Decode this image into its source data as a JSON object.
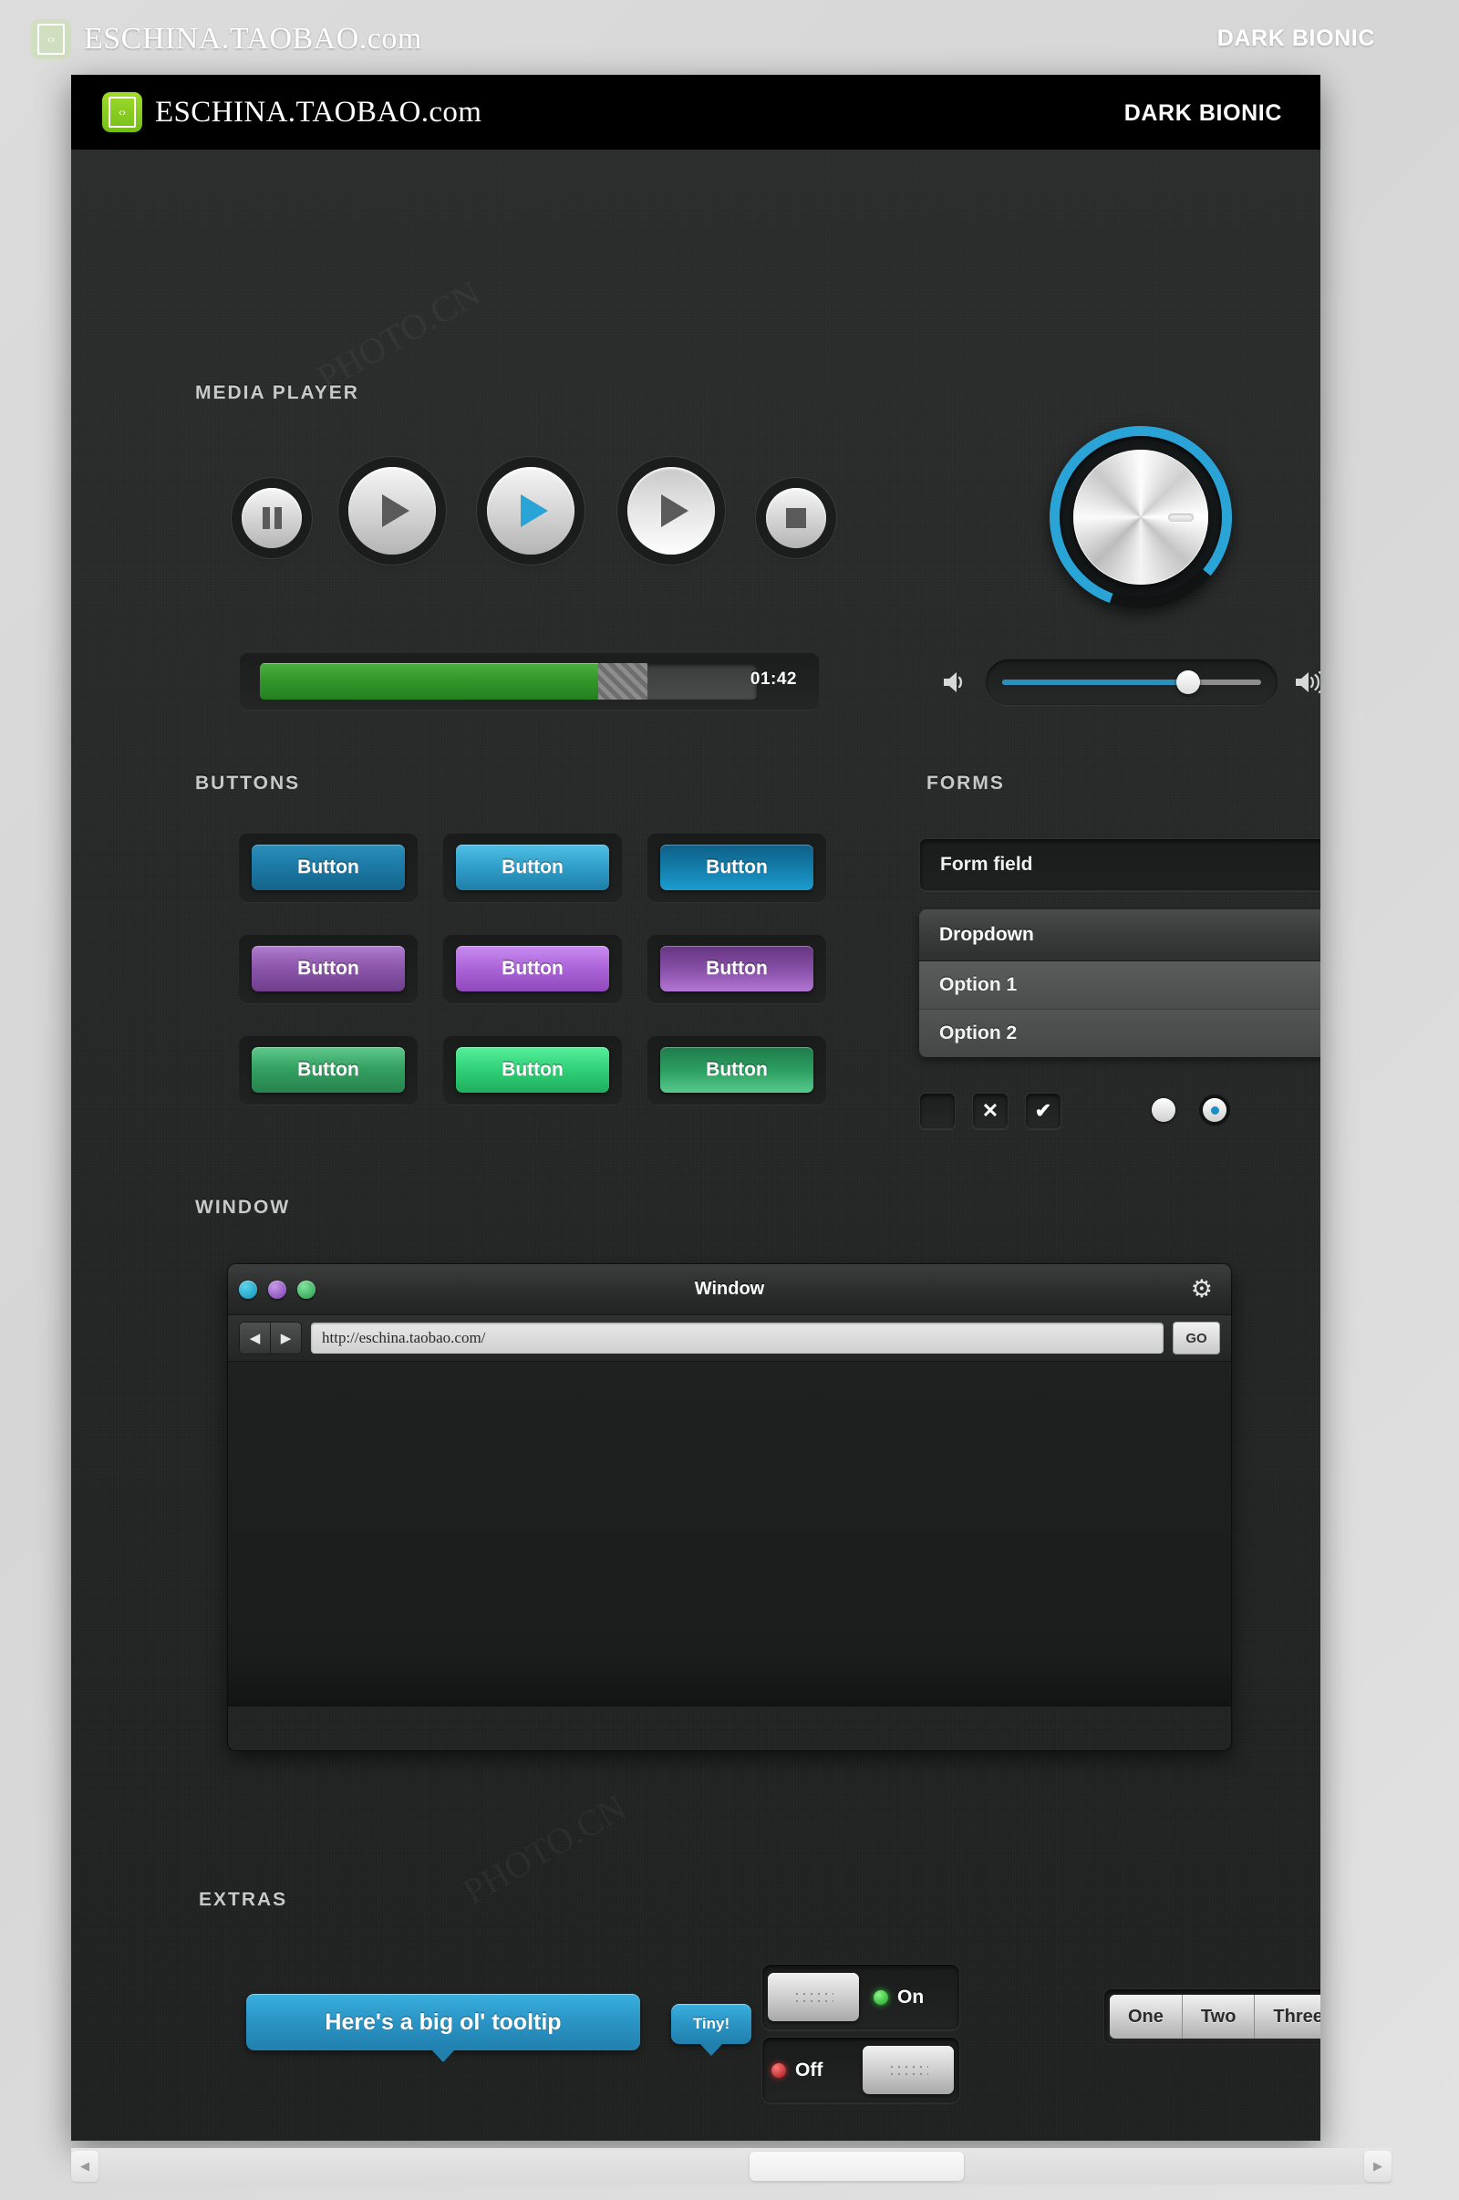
{
  "outer": {
    "brand": "ESCHINA.TAOBAO.com",
    "theme_label": "DARK BIONIC",
    "logo_icon": "code-brackets-icon"
  },
  "kit": {
    "brand": "ESCHINA.TAOBAO.com",
    "theme_label": "DARK BIONIC",
    "logo_icon": "code-brackets-icon",
    "accent_blue": "#2a94c4",
    "accent_green": "#2f9329",
    "panel_bg": "#242626"
  },
  "media_player": {
    "title": "MEDIA PLAYER",
    "transport": [
      {
        "name": "pause-button",
        "icon": "pause-icon",
        "size": "small",
        "color": "#5a5a5a"
      },
      {
        "name": "play-button-large",
        "icon": "play-icon",
        "size": "large",
        "color": "#5a5a5a"
      },
      {
        "name": "play-button-active",
        "icon": "play-icon",
        "size": "large",
        "color": "#2aa4d6"
      },
      {
        "name": "play-button-pressed",
        "icon": "play-icon",
        "size": "large",
        "color": "#5a5a5a"
      },
      {
        "name": "stop-button",
        "icon": "stop-icon",
        "size": "small",
        "color": "#5a5a5a"
      }
    ],
    "progress": {
      "played_percent": 68,
      "buffered_percent": 10,
      "time": "01:42"
    },
    "knob": {
      "name": "volume-knob",
      "value_percent": 80,
      "ring_color": "#2aa4d6"
    },
    "volume": {
      "icon_low": "speaker-low-icon",
      "icon_high": "speaker-high-icon",
      "value_percent": 72,
      "fill_color": "#2a8fba"
    }
  },
  "buttons_section": {
    "title": "BUTTONS",
    "label": "Button",
    "rows": [
      {
        "name": "blue",
        "variants": [
          {
            "state": "normal",
            "gradient": "linear-gradient(180deg,#2a8fba 0%,#1d7ba6 45%,#14648c 100%)"
          },
          {
            "state": "hover",
            "gradient": "linear-gradient(180deg,#4fc0e6 0%,#2f9ec9 50%,#1f7fa8 100%)"
          },
          {
            "state": "pressed",
            "gradient": "linear-gradient(180deg,#0d5e86 0%,#1480ad 55%,#1b9ccf 100%)"
          }
        ]
      },
      {
        "name": "purple",
        "variants": [
          {
            "state": "normal",
            "gradient": "linear-gradient(180deg,#b07dd0 0%,#8d57ac 45%,#6f3e8c 100%)"
          },
          {
            "state": "hover",
            "gradient": "linear-gradient(180deg,#c98cf0 0%,#ab63d8 50%,#9048bc 100%)"
          },
          {
            "state": "pressed",
            "gradient": "linear-gradient(180deg,#653580 0%,#8a52ab 55%,#b176d2 100%)"
          }
        ]
      },
      {
        "name": "green",
        "variants": [
          {
            "state": "normal",
            "gradient": "linear-gradient(180deg,#5fc98a 0%,#34a263 45%,#27824d 100%)"
          },
          {
            "state": "hover",
            "gradient": "linear-gradient(180deg,#55f09a 0%,#2fd077 50%,#1fae5e 100%)"
          },
          {
            "state": "pressed",
            "gradient": "linear-gradient(180deg,#1e7a4a 0%,#2ea264 55%,#59c98c 100%)"
          }
        ]
      }
    ]
  },
  "forms": {
    "title": "FORMS",
    "field_value": "Form field",
    "field_placeholder": "Form field",
    "dropdown": {
      "selected": "Dropdown",
      "arrow_icon": "chevron-down-icon",
      "options": [
        "Option 1",
        "Option 2"
      ]
    },
    "checkboxes": [
      {
        "name": "checkbox-empty",
        "glyph": ""
      },
      {
        "name": "checkbox-cross",
        "glyph": "✕"
      },
      {
        "name": "checkbox-check",
        "glyph": "✔"
      }
    ],
    "radios": [
      {
        "name": "radio-unselected",
        "selected": false
      },
      {
        "name": "radio-selected",
        "selected": true
      }
    ]
  },
  "window_section": {
    "title": "WINDOW",
    "window": {
      "title": "Window",
      "gear_icon": "gear-icon",
      "dots": [
        {
          "name": "window-dot-teal",
          "color": "#19a0c4"
        },
        {
          "name": "window-dot-purple",
          "color": "#8d4fc4"
        },
        {
          "name": "window-dot-green",
          "color": "#34b35c"
        }
      ],
      "back_icon": "◀",
      "forward_icon": "▶",
      "url": "http://eschina.taobao.com/",
      "go_label": "GO"
    }
  },
  "extras": {
    "title": "EXTRAS",
    "tooltip_big": "Here's a big ol' tooltip",
    "tooltip_tiny": "Tiny!",
    "switches": [
      {
        "name": "toggle-on",
        "label": "On",
        "state": "on",
        "led_color": "#35c73a",
        "handle_side": "left"
      },
      {
        "name": "toggle-off",
        "label": "Off",
        "state": "off",
        "led_color": "#d02a2a",
        "handle_side": "right"
      }
    ],
    "segmented": {
      "options": [
        "One",
        "Two",
        "Three"
      ],
      "selected": "One"
    }
  },
  "scrollbars": {
    "inner": {
      "left_arrow": "◀",
      "right_arrow": "▶",
      "thumb_position_percent": 65
    },
    "outer": {
      "left_arrow": "◀",
      "right_arrow": "▶",
      "thumb_position_percent": 62
    }
  }
}
